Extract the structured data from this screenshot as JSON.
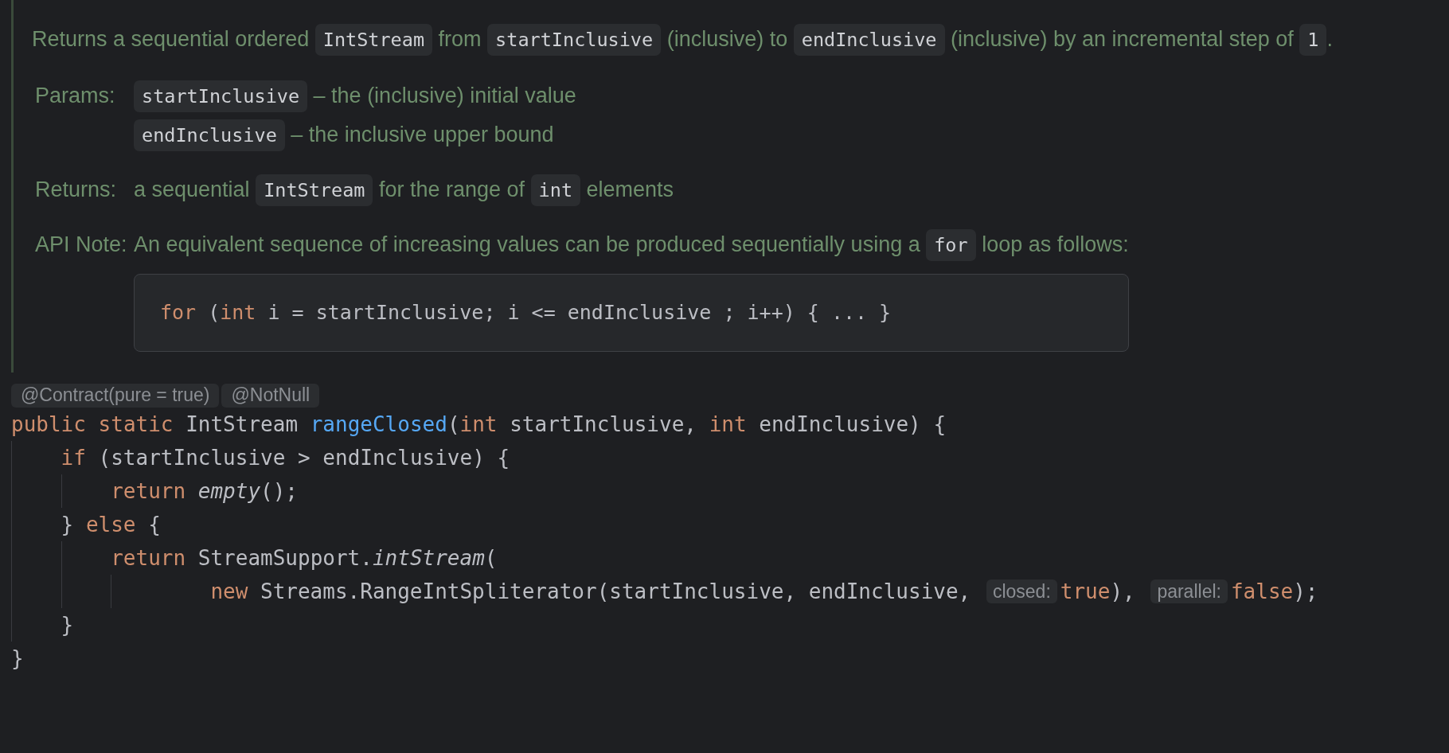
{
  "doc": {
    "description": [
      {
        "kind": "text",
        "text": "Returns a sequential ordered "
      },
      {
        "kind": "code",
        "text": "IntStream"
      },
      {
        "kind": "text",
        "text": " from "
      },
      {
        "kind": "code",
        "text": "startInclusive"
      },
      {
        "kind": "text",
        "text": " (inclusive) to "
      },
      {
        "kind": "code",
        "text": "endInclusive"
      },
      {
        "kind": "text",
        "text": " (inclusive) by an incremental step of "
      },
      {
        "kind": "code",
        "text": "1"
      },
      {
        "kind": "text",
        "text": "."
      }
    ],
    "sections": [
      {
        "label": "Params:",
        "items": [
          {
            "kind": "text",
            "segments": [
              {
                "kind": "code",
                "text": "startInclusive"
              },
              {
                "kind": "text",
                "text": " – the (inclusive) initial value"
              }
            ]
          },
          {
            "kind": "text",
            "segments": [
              {
                "kind": "code",
                "text": "endInclusive"
              },
              {
                "kind": "text",
                "text": " – the inclusive upper bound"
              }
            ]
          }
        ]
      },
      {
        "label": "Returns:",
        "items": [
          {
            "kind": "text",
            "segments": [
              {
                "kind": "text",
                "text": "a sequential "
              },
              {
                "kind": "code",
                "text": "IntStream"
              },
              {
                "kind": "text",
                "text": " for the range of "
              },
              {
                "kind": "code",
                "text": "int"
              },
              {
                "kind": "text",
                "text": " elements"
              }
            ]
          }
        ]
      },
      {
        "label": "API Note:",
        "items": [
          {
            "kind": "text",
            "segments": [
              {
                "kind": "text",
                "text": "An equivalent sequence of increasing values can be produced sequentially using a "
              },
              {
                "kind": "code",
                "text": "for"
              },
              {
                "kind": "text",
                "text": " loop as follows:"
              }
            ]
          },
          {
            "kind": "code_block",
            "tokens": [
              {
                "kind": "keyword",
                "text": "for"
              },
              {
                "kind": "plain",
                "text": " ("
              },
              {
                "kind": "keyword",
                "text": "int"
              },
              {
                "kind": "plain",
                "text": " i = startInclusive; i <= endInclusive ; i++) { ... }"
              }
            ]
          }
        ]
      }
    ]
  },
  "annotations": [
    "@Contract(pure = true)",
    "@NotNull"
  ],
  "code_lines": [
    {
      "tokens": [
        {
          "kind": "keyword",
          "text": "public static "
        },
        {
          "kind": "plain",
          "text": "IntStream "
        },
        {
          "kind": "method",
          "text": "rangeClosed"
        },
        {
          "kind": "plain",
          "text": "("
        },
        {
          "kind": "keyword",
          "text": "int "
        },
        {
          "kind": "plain",
          "text": "startInclusive, "
        },
        {
          "kind": "keyword",
          "text": "int "
        },
        {
          "kind": "plain",
          "text": "endInclusive) {"
        }
      ],
      "children": [
        {
          "tokens": [
            {
              "kind": "keyword",
              "text": "if "
            },
            {
              "kind": "plain",
              "text": "(startInclusive > endInclusive) {"
            }
          ],
          "children": [
            {
              "tokens": [
                {
                  "kind": "keyword",
                  "text": "return "
                },
                {
                  "kind": "italic",
                  "text": "empty"
                },
                {
                  "kind": "plain",
                  "text": "();"
                }
              ]
            }
          ]
        },
        {
          "tokens": [
            {
              "kind": "plain",
              "text": "} "
            },
            {
              "kind": "keyword",
              "text": "else "
            },
            {
              "kind": "plain",
              "text": "{"
            }
          ],
          "children": [
            {
              "tokens": [
                {
                  "kind": "keyword",
                  "text": "return "
                },
                {
                  "kind": "plain",
                  "text": "StreamSupport."
                },
                {
                  "kind": "italic",
                  "text": "intStream"
                },
                {
                  "kind": "plain",
                  "text": "("
                }
              ],
              "children": [
                {
                  "kind": "continuation",
                  "tokens": [
                    {
                      "kind": "keyword",
                      "text": "new "
                    },
                    {
                      "kind": "plain",
                      "text": "Streams.RangeIntSpliterator(startInclusive, endInclusive, "
                    },
                    {
                      "kind": "hint",
                      "text": "closed:"
                    },
                    {
                      "kind": "keyword",
                      "text": "true"
                    },
                    {
                      "kind": "plain",
                      "text": "), "
                    },
                    {
                      "kind": "hint",
                      "text": "parallel:"
                    },
                    {
                      "kind": "keyword",
                      "text": "false"
                    },
                    {
                      "kind": "plain",
                      "text": ");"
                    }
                  ]
                }
              ]
            }
          ]
        },
        {
          "tokens": [
            {
              "kind": "plain",
              "text": "}"
            }
          ]
        }
      ]
    },
    {
      "tokens": [
        {
          "kind": "plain",
          "text": "}"
        }
      ]
    }
  ]
}
